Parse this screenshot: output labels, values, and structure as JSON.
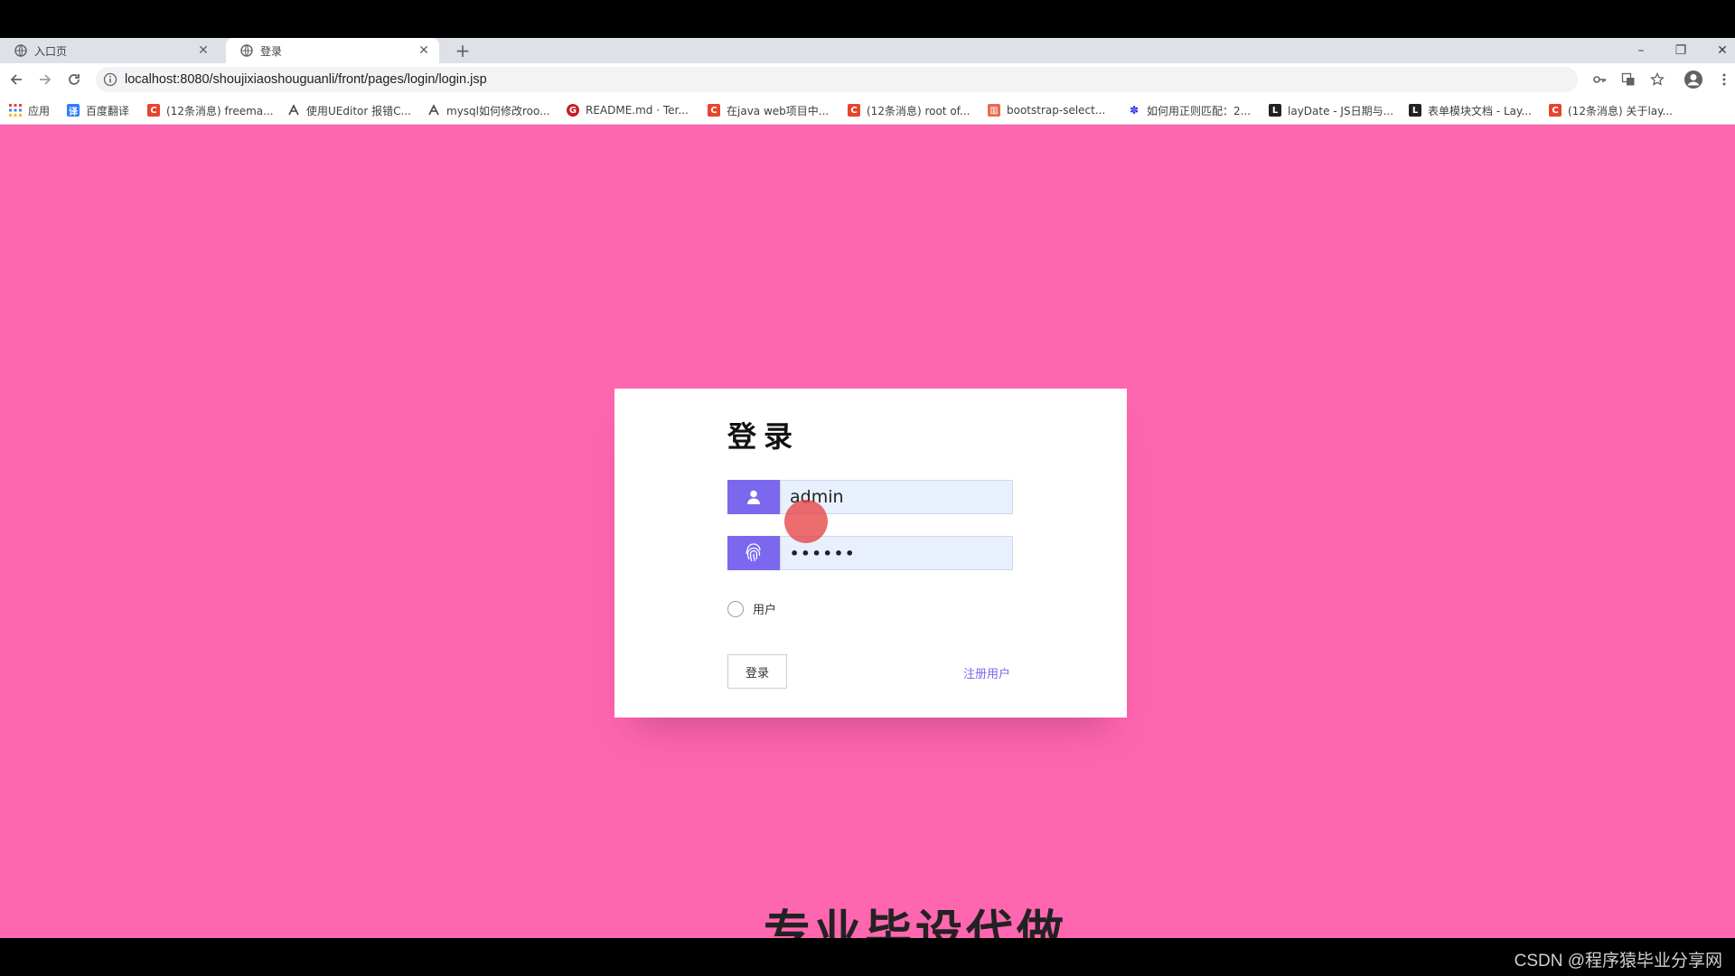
{
  "browser": {
    "tabs": [
      {
        "title": "入口页"
      },
      {
        "title": "登录"
      }
    ],
    "new_tab_label": "+",
    "url": "localhost:8080/shoujixiaoshouguanli/front/pages/login/login.jsp"
  },
  "bookmarks": [
    {
      "label": "应用",
      "icon": "apps-grid-icon"
    },
    {
      "label": "百度翻译",
      "icon": "baidu-translate-icon"
    },
    {
      "label": "(12条消息) freema...",
      "icon": "csdn-icon"
    },
    {
      "label": "使用UEditor 报错C...",
      "icon": "bookmark-icon"
    },
    {
      "label": "mysql如何修改roo...",
      "icon": "bookmark-icon"
    },
    {
      "label": "README.md · Ter...",
      "icon": "gitee-icon"
    },
    {
      "label": "在java web项目中...",
      "icon": "csdn-icon"
    },
    {
      "label": "(12条消息) root of...",
      "icon": "csdn-icon"
    },
    {
      "label": "bootstrap-select...",
      "icon": "bookmark-icon"
    },
    {
      "label": "如何用正则匹配：2...",
      "icon": "baidu-icon"
    },
    {
      "label": "layDate - JS日期与...",
      "icon": "layui-icon"
    },
    {
      "label": "表单模块文档 - Lay...",
      "icon": "layui-icon"
    },
    {
      "label": "(12条消息) 关于lay...",
      "icon": "csdn-icon"
    }
  ],
  "login": {
    "title": "登录",
    "username_value": "admin",
    "password_value": "••••••",
    "role_option": "用户",
    "login_button": "登录",
    "register_link": "注册用户"
  },
  "page": {
    "subtitle": "专业毕设代做"
  },
  "watermark": "CSDN @程序猿毕业分享网",
  "colors": {
    "page_background": "#ff66b0",
    "accent": "#7b68ee",
    "input_background": "#e8f0fe",
    "csdn_red": "#e5452f"
  }
}
